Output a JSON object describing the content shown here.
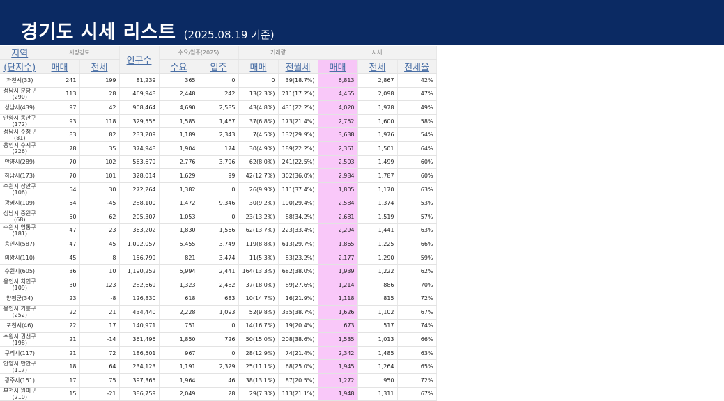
{
  "header": {
    "title": "경기도 시세 리스트",
    "subtitle": "(2025.08.19 기준)"
  },
  "colors": {
    "banner": "#0b2a63",
    "highlight": "#f9c8f9"
  },
  "table": {
    "group_headers": {
      "region_top": "지역",
      "region_bottom": "(단지수)",
      "market": "시장강도",
      "population": "인구수",
      "supply": "수요/입주(2025)",
      "volume": "거래량",
      "price": "시세"
    },
    "sub_headers": {
      "market_sale": "매매",
      "market_jeonse": "전세",
      "demand": "수요",
      "move_in": "입주",
      "volume_sale": "매매",
      "volume_rent": "전월세",
      "price_sale": "매매",
      "price_jeonse": "전세",
      "jeonse_ratio": "전세율"
    },
    "rows": [
      [
        "과천시(33)",
        "241",
        "199",
        "81,239",
        "365",
        "0",
        "0",
        "39(18.7%)",
        "6,813",
        "2,867",
        "42%"
      ],
      [
        "성남시 분당구(290)",
        "113",
        "28",
        "469,948",
        "2,448",
        "242",
        "13(2.3%)",
        "211(17.2%)",
        "4,455",
        "2,098",
        "47%"
      ],
      [
        "성남시(439)",
        "97",
        "42",
        "908,464",
        "4,690",
        "2,585",
        "43(4.8%)",
        "431(22.2%)",
        "4,020",
        "1,978",
        "49%"
      ],
      [
        "안양시 동안구(172)",
        "93",
        "118",
        "329,556",
        "1,585",
        "1,467",
        "37(6.8%)",
        "173(21.4%)",
        "2,752",
        "1,600",
        "58%"
      ],
      [
        "성남시 수정구(81)",
        "83",
        "82",
        "233,209",
        "1,189",
        "2,343",
        "7(4.5%)",
        "132(29.9%)",
        "3,638",
        "1,976",
        "54%"
      ],
      [
        "용인시 수지구(226)",
        "78",
        "35",
        "374,948",
        "1,904",
        "174",
        "30(4.9%)",
        "189(22.2%)",
        "2,361",
        "1,501",
        "64%"
      ],
      [
        "안양시(289)",
        "70",
        "102",
        "563,679",
        "2,776",
        "3,796",
        "62(8.0%)",
        "241(22.5%)",
        "2,503",
        "1,499",
        "60%"
      ],
      [
        "하남시(173)",
        "70",
        "101",
        "328,014",
        "1,629",
        "99",
        "42(12.7%)",
        "302(36.0%)",
        "2,984",
        "1,787",
        "60%"
      ],
      [
        "수원시 장안구(106)",
        "54",
        "30",
        "272,264",
        "1,382",
        "0",
        "26(9.9%)",
        "111(37.4%)",
        "1,805",
        "1,170",
        "63%"
      ],
      [
        "광명시(109)",
        "54",
        "-45",
        "288,100",
        "1,472",
        "9,346",
        "30(9.2%)",
        "190(29.4%)",
        "2,584",
        "1,374",
        "53%"
      ],
      [
        "성남시 중원구(68)",
        "50",
        "62",
        "205,307",
        "1,053",
        "0",
        "23(13.2%)",
        "88(34.2%)",
        "2,681",
        "1,519",
        "57%"
      ],
      [
        "수원시 영통구(181)",
        "47",
        "23",
        "363,202",
        "1,830",
        "1,566",
        "62(13.7%)",
        "223(33.4%)",
        "2,294",
        "1,441",
        "63%"
      ],
      [
        "용인시(587)",
        "47",
        "45",
        "1,092,057",
        "5,455",
        "3,749",
        "119(8.8%)",
        "613(29.7%)",
        "1,865",
        "1,225",
        "66%"
      ],
      [
        "의왕시(110)",
        "45",
        "8",
        "156,799",
        "821",
        "3,474",
        "11(5.3%)",
        "83(23.2%)",
        "2,177",
        "1,290",
        "59%"
      ],
      [
        "수원시(605)",
        "36",
        "10",
        "1,190,252",
        "5,994",
        "2,441",
        "164(13.3%)",
        "682(38.0%)",
        "1,939",
        "1,222",
        "62%"
      ],
      [
        "용인시 처인구(109)",
        "30",
        "123",
        "282,669",
        "1,323",
        "2,482",
        "37(18.0%)",
        "89(27.6%)",
        "1,214",
        "886",
        "70%"
      ],
      [
        "양평군(34)",
        "23",
        "-8",
        "126,830",
        "618",
        "683",
        "10(14.7%)",
        "16(21.9%)",
        "1,118",
        "815",
        "72%"
      ],
      [
        "용인시 기흥구(252)",
        "22",
        "21",
        "434,440",
        "2,228",
        "1,093",
        "52(9.8%)",
        "335(38.7%)",
        "1,626",
        "1,102",
        "67%"
      ],
      [
        "포천시(46)",
        "22",
        "17",
        "140,971",
        "751",
        "0",
        "14(16.7%)",
        "19(20.4%)",
        "673",
        "517",
        "74%"
      ],
      [
        "수원시 권선구(198)",
        "21",
        "-14",
        "361,496",
        "1,850",
        "726",
        "50(15.0%)",
        "208(38.6%)",
        "1,535",
        "1,013",
        "66%"
      ],
      [
        "구리시(117)",
        "21",
        "72",
        "186,501",
        "967",
        "0",
        "28(12.9%)",
        "74(21.4%)",
        "2,342",
        "1,485",
        "63%"
      ],
      [
        "안양시 만안구(117)",
        "18",
        "64",
        "234,123",
        "1,191",
        "2,329",
        "25(11.1%)",
        "68(25.0%)",
        "1,945",
        "1,264",
        "65%"
      ],
      [
        "광주시(151)",
        "17",
        "75",
        "397,365",
        "1,964",
        "46",
        "38(13.1%)",
        "87(20.5%)",
        "1,272",
        "950",
        "72%"
      ],
      [
        "부천시 원미구(210)",
        "15",
        "-21",
        "386,759",
        "2,049",
        "28",
        "29(7.3%)",
        "113(21.1%)",
        "1,948",
        "1,311",
        "67%"
      ]
    ]
  }
}
